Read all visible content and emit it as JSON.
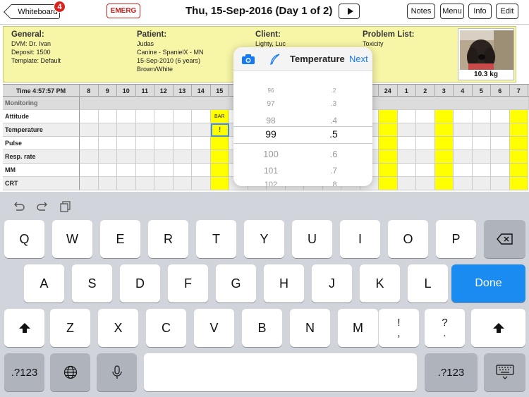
{
  "header": {
    "whiteboard_label": "Whiteboard",
    "whiteboard_badge": "4",
    "emerg_label": "EMERG",
    "date_title": "Thu, 15-Sep-2016 (Day 1 of 2)",
    "notes_label": "Notes",
    "menu_label": "Menu",
    "info_label": "Info",
    "edit_label": "Edit"
  },
  "patient_info": {
    "general": {
      "heading": "General:",
      "lines": [
        "DVM: Dr. Ivan",
        "Deposit: 1500",
        "Template: Default"
      ]
    },
    "patient": {
      "heading": "Patient:",
      "lines": [
        "Judas",
        "Canine - SpanielX - MN",
        "15-Sep-2010 (6 years)",
        "Brown/White"
      ]
    },
    "client": {
      "heading": "Client:",
      "lines": [
        "Lighty, Luc"
      ]
    },
    "problems": {
      "heading": "Problem List:",
      "lines": [
        "Toxicity"
      ]
    },
    "weight": "10.3 kg"
  },
  "grid": {
    "time_label": "Time 4:57:57 PM",
    "hours": [
      "8",
      "9",
      "10",
      "11",
      "12",
      "13",
      "14",
      "15",
      "",
      "",
      "",
      "",
      "",
      "",
      "",
      "",
      "24",
      "1",
      "2",
      "3",
      "4",
      "5",
      "6",
      "7"
    ],
    "section": "Monitoring",
    "rows": [
      "Attitude",
      "Temperature",
      "Pulse",
      "Resp. rate",
      "MM",
      "CRT"
    ],
    "bar_cell_text": "BAR",
    "selected_cell_text": "!"
  },
  "picker": {
    "title": "Temperature",
    "next_label": "Next",
    "integers": [
      "96",
      "97",
      "98",
      "99",
      "100",
      "101",
      "102"
    ],
    "decimals": [
      ".2",
      ".3",
      ".4",
      ".5",
      ".6",
      ".7",
      ".8"
    ],
    "selected_integer": "99",
    "selected_decimal": ".5"
  },
  "keyboard": {
    "row1": [
      "Q",
      "W",
      "E",
      "R",
      "T",
      "Y",
      "U",
      "I",
      "O",
      "P"
    ],
    "row2": [
      "A",
      "S",
      "D",
      "F",
      "G",
      "H",
      "J",
      "K",
      "L"
    ],
    "row3": [
      "Z",
      "X",
      "C",
      "V",
      "B",
      "N",
      "M"
    ],
    "excl_top": "!",
    "excl_bottom": ",",
    "quest_top": "?",
    "quest_bottom": ".",
    "done_label": "Done",
    "numbers_label": ".?123"
  }
}
